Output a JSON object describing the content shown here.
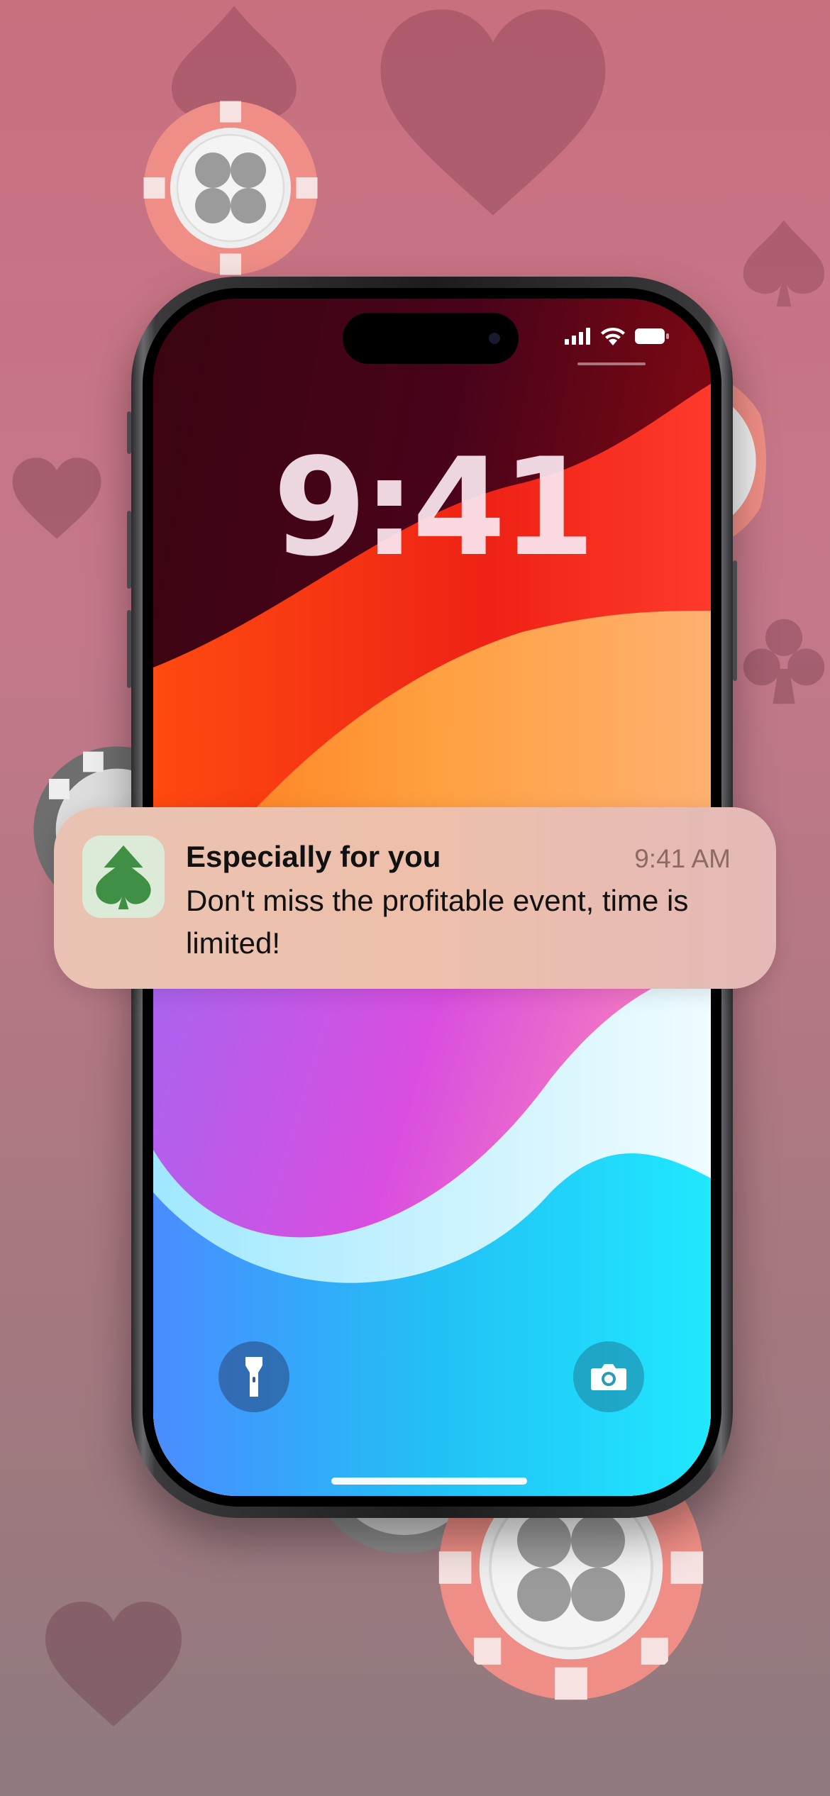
{
  "lock_screen": {
    "time": "9:41"
  },
  "status_bar": {
    "signal_icon": "cellular-signal-icon",
    "wifi_icon": "wifi-icon",
    "battery_icon": "battery-full-icon"
  },
  "notification": {
    "app_icon": "spade-icon",
    "title": "Especially for you",
    "time": "9:41 AM",
    "body": "Don't miss the profitable event, time is limited!"
  },
  "quick_actions": {
    "left_icon": "flashlight-icon",
    "right_icon": "camera-icon"
  },
  "colors": {
    "background": "#c4788a",
    "spade_green": "#3f8f45",
    "chip_red": "#ee8f87",
    "chip_gray": "#9a9a9a"
  }
}
